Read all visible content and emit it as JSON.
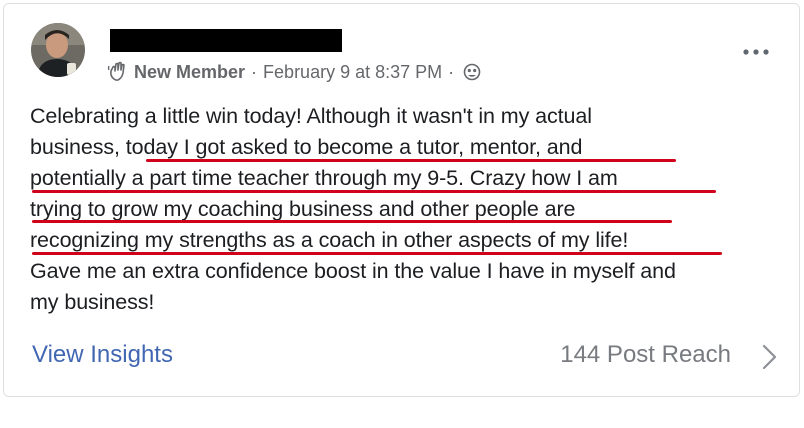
{
  "post": {
    "member_badge": "New Member",
    "separator": "·",
    "timestamp": "February 9 at 8:37 PM",
    "privacy_icon": "globe-icon",
    "badge_icon": "waving-hand-icon",
    "more_icon": "more-options-icon",
    "body_lines": [
      "Celebrating a little win today! Although it wasn't in my actual",
      "business, today I got asked to become a tutor, mentor, and",
      "potentially a part time teacher through my 9-5. Crazy how I am",
      "trying to grow my coaching business and other people are",
      "recognizing my strengths as a coach in other aspects of my life!",
      "Gave me an extra confidence boost in the value I have in myself and",
      "my business!"
    ],
    "underline_color": "#d0021b"
  },
  "footer": {
    "view_insights_label": "View Insights",
    "reach_label": "144 Post Reach",
    "link_color": "#4267b2",
    "chevron_icon": "chevron-right-icon"
  }
}
